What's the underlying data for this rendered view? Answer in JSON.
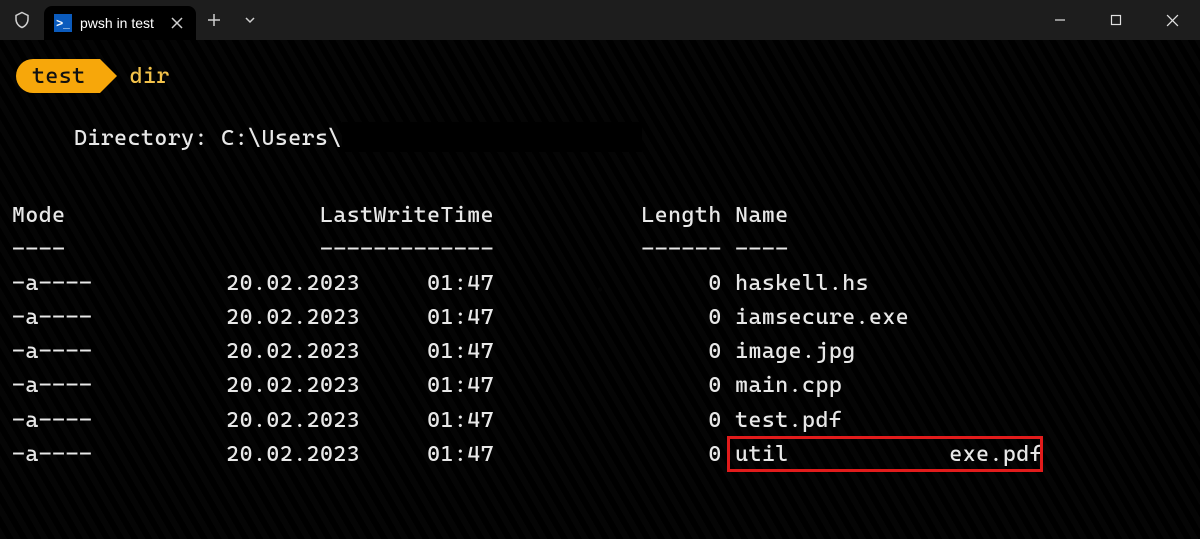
{
  "window": {
    "tab_title": "pwsh in test"
  },
  "prompt": {
    "chip": "test",
    "command": "dir"
  },
  "directory_line": "Directory: C:\\Users\\",
  "listing": {
    "headers": {
      "mode": "Mode",
      "lwt": "LastWriteTime",
      "length": "Length",
      "name": "Name"
    },
    "rows": [
      {
        "mode": "-a----",
        "date": "20.02.2023",
        "time": "01:47",
        "length": "0",
        "name": "haskell.hs"
      },
      {
        "mode": "-a----",
        "date": "20.02.2023",
        "time": "01:47",
        "length": "0",
        "name": "iamsecure.exe"
      },
      {
        "mode": "-a----",
        "date": "20.02.2023",
        "time": "01:47",
        "length": "0",
        "name": "image.jpg"
      },
      {
        "mode": "-a----",
        "date": "20.02.2023",
        "time": "01:47",
        "length": "0",
        "name": "main.cpp"
      },
      {
        "mode": "-a----",
        "date": "20.02.2023",
        "time": "01:47",
        "length": "0",
        "name": "test.pdf"
      },
      {
        "mode": "-a----",
        "date": "20.02.2023",
        "time": "01:47",
        "length": "0",
        "name": "util            exe.pdf"
      }
    ]
  }
}
